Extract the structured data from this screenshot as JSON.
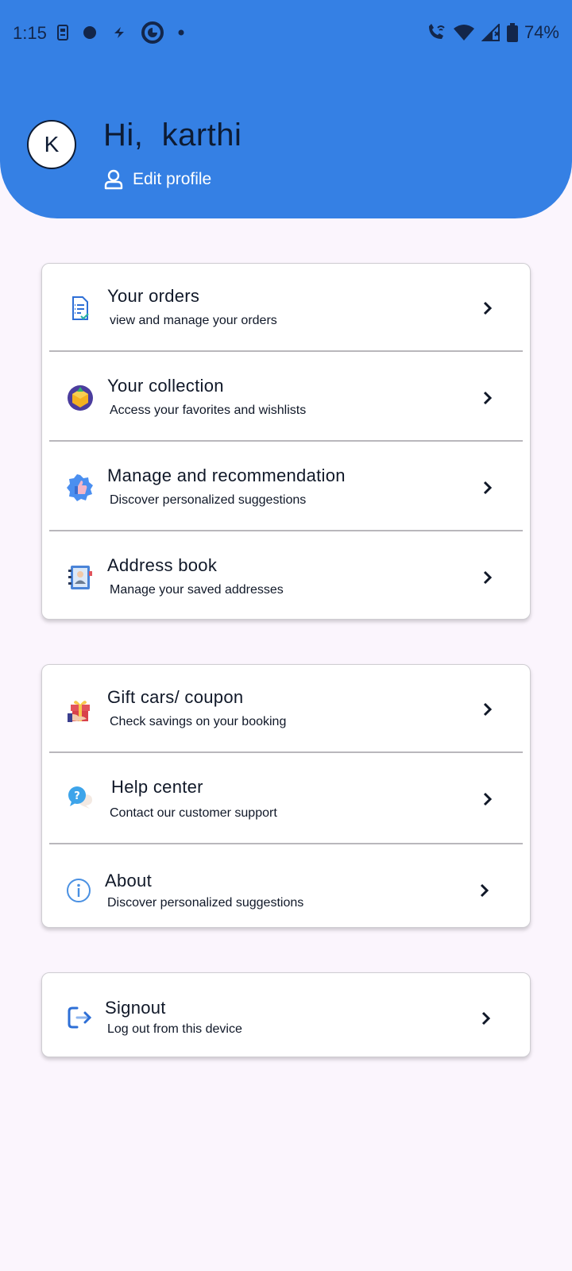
{
  "status_bar": {
    "time": "1:15",
    "battery": "74%"
  },
  "header": {
    "avatar_initial": "K",
    "greeting": "Hi,  karthi",
    "edit_profile_label": "Edit profile"
  },
  "menu_group_1": [
    {
      "title": "Your orders",
      "subtitle": "view and manage your orders",
      "icon": "orders-icon"
    },
    {
      "title": "Your collection",
      "subtitle": "Access your favorites and wishlists",
      "icon": "collection-icon"
    },
    {
      "title": "Manage and recommendation",
      "subtitle": "Discover personalized suggestions",
      "icon": "recommendation-icon"
    },
    {
      "title": "Address book",
      "subtitle": "Manage your saved addresses",
      "icon": "address-book-icon"
    }
  ],
  "menu_group_2": [
    {
      "title": "Gift cars/ coupon",
      "subtitle": "Check savings on your booking",
      "icon": "gift-icon"
    },
    {
      "title": "Help center",
      "subtitle": "Contact our customer support",
      "icon": "help-icon"
    },
    {
      "title": "About",
      "subtitle": "Discover personalized suggestions",
      "icon": "info-icon"
    }
  ],
  "menu_group_3": [
    {
      "title": "Signout",
      "subtitle": "Log out from this device",
      "icon": "signout-icon"
    }
  ],
  "colors": {
    "header_blue": "#3580e4",
    "page_background": "#fbf5fd",
    "text_dark": "#101828"
  }
}
